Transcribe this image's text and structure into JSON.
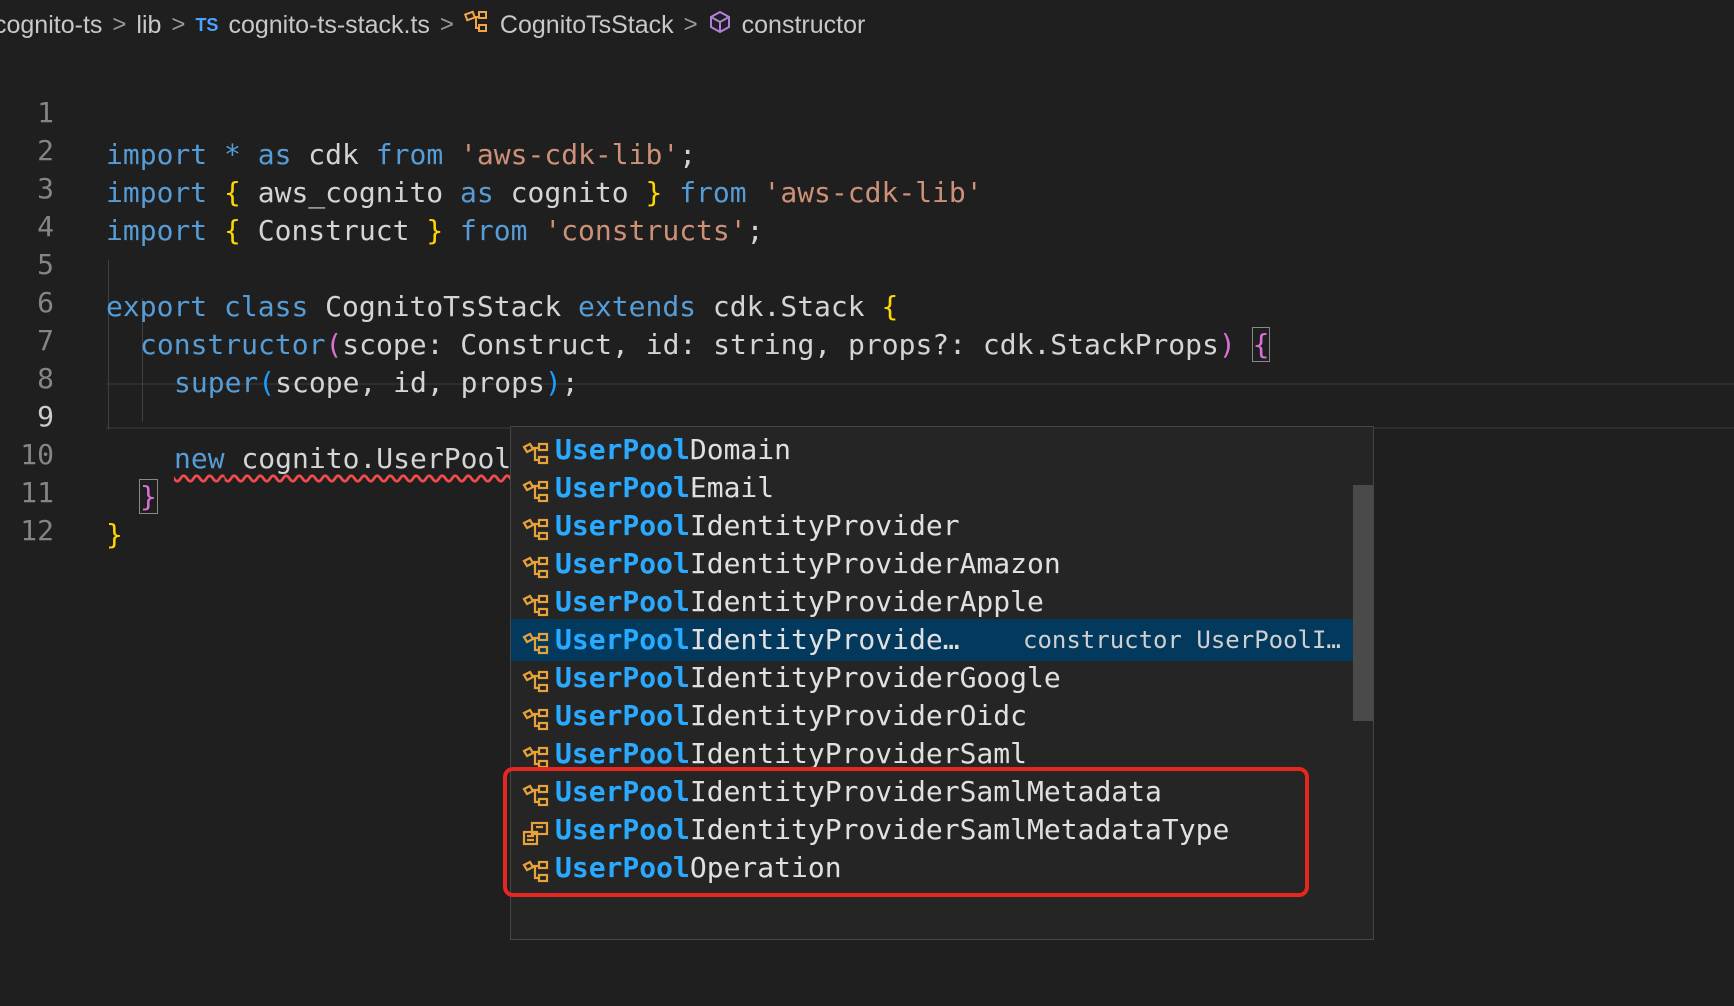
{
  "breadcrumb": {
    "folder": "cognito-ts",
    "subfolder": "lib",
    "file_badge": "TS",
    "file": "cognito-ts-stack.ts",
    "class_name": "CognitoTsStack",
    "member": "constructor",
    "separator": ">"
  },
  "editor": {
    "active_line": 9,
    "line_numbers": [
      "1",
      "2",
      "3",
      "4",
      "5",
      "6",
      "7",
      "8",
      "9",
      "10",
      "11",
      "12"
    ],
    "tokens": {
      "l1_import": "import",
      "l1_star": " * ",
      "l1_as": "as",
      "l1_cdk": " cdk ",
      "l1_from": "from",
      "l1_str": "'aws-cdk-lib'",
      "l1_semi": ";",
      "l2_import": "import",
      "l2_open": "{",
      "l2_name": " aws_cognito ",
      "l2_as": "as",
      "l2_alias": " cognito ",
      "l2_close": "}",
      "l2_from": "from",
      "l2_str": "'aws-cdk-lib'",
      "l3_import": "import",
      "l3_open": "{",
      "l3_name": " Construct ",
      "l3_close": "}",
      "l3_from": "from",
      "l3_str": "'constructs'",
      "l3_semi": ";",
      "l5_export": "export",
      "l5_class": "class",
      "l5_name": " CognitoTsStack ",
      "l5_extends": "extends",
      "l5_base": " cdk.Stack ",
      "l5_open": "{",
      "l6_ctor": "constructor",
      "l6_paren_open": "(",
      "l6_params": "scope: Construct, id: string, props?: cdk.StackProps",
      "l6_paren_close": ")",
      "l6_open": "{",
      "l7_super": "super",
      "l7_paren_open": "(",
      "l7_args": "scope, id, props",
      "l7_paren_close": ")",
      "l7_semi": ";",
      "l9_new": "new",
      "l9_expr": " cognito.UserPool",
      "l10_close": "}",
      "l11_close": "}"
    }
  },
  "suggest": {
    "match": "UserPool",
    "items": [
      {
        "rest": "Domain",
        "icon": "class-icon"
      },
      {
        "rest": "Email",
        "icon": "class-icon"
      },
      {
        "rest": "IdentityProvider",
        "icon": "class-icon"
      },
      {
        "rest": "IdentityProviderAmazon",
        "icon": "class-icon"
      },
      {
        "rest": "IdentityProviderApple",
        "icon": "class-icon"
      },
      {
        "rest": "IdentityProvide…",
        "icon": "class-icon",
        "selected": true,
        "detail": "constructor UserPoolI…"
      },
      {
        "rest": "IdentityProviderGoogle",
        "icon": "class-icon"
      },
      {
        "rest": "IdentityProviderOidc",
        "icon": "class-icon"
      },
      {
        "rest": "IdentityProviderSaml",
        "icon": "class-icon"
      },
      {
        "rest": "IdentityProviderSamlMetadata",
        "icon": "class-icon"
      },
      {
        "rest": "IdentityProviderSamlMetadataType",
        "icon": "enum-icon"
      },
      {
        "rest": "Operation",
        "icon": "class-icon"
      }
    ]
  },
  "colors": {
    "highlight_box": "#e5281f",
    "selected_row": "#04395e",
    "match_text": "#2aaaff",
    "class_icon": "#e8a23a"
  }
}
